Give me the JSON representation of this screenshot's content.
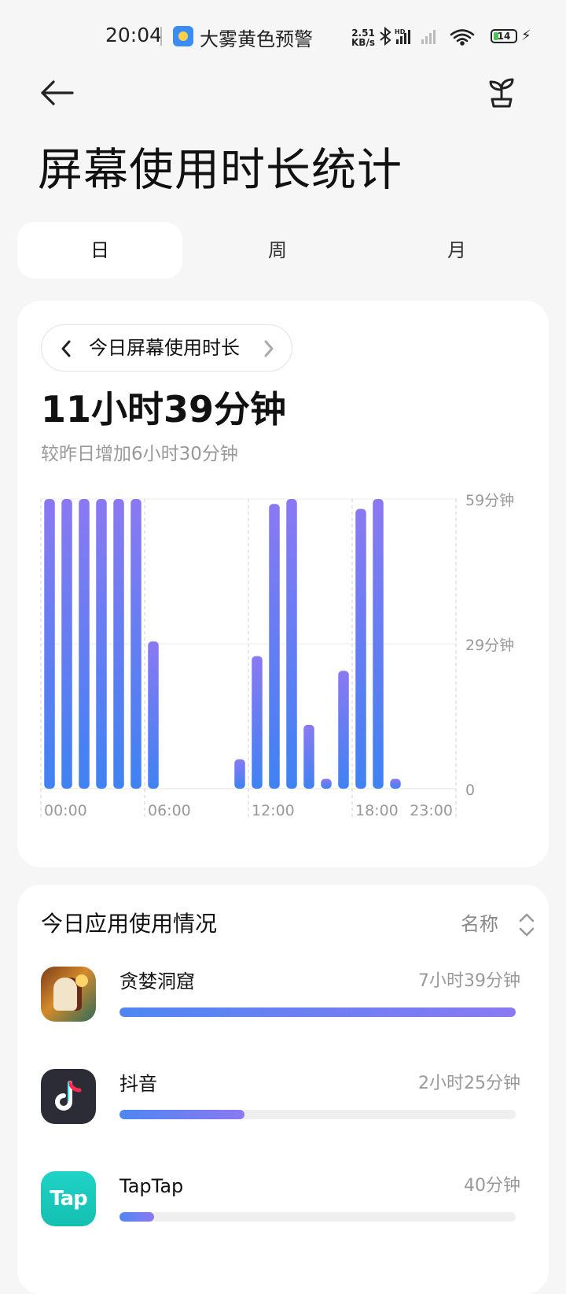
{
  "status_bar": {
    "time": "20:04",
    "alert": "大雾黄色预警",
    "net_speed_value": "2.51",
    "net_speed_unit": "KB/s",
    "battery": "14"
  },
  "header": {
    "title": "屏幕使用时长统计",
    "back_icon": "arrow-left-icon",
    "action_icon": "sprout-icon"
  },
  "tabs": [
    {
      "label": "日",
      "active": true
    },
    {
      "label": "周",
      "active": false
    },
    {
      "label": "月",
      "active": false
    }
  ],
  "usage": {
    "date_label": "今日屏幕使用时长",
    "total": "11小时39分钟",
    "delta": "较昨日增加6小时30分钟"
  },
  "chart_data": {
    "type": "bar",
    "unit": "分钟",
    "categories": [
      "00:00",
      "01:00",
      "02:00",
      "03:00",
      "04:00",
      "05:00",
      "06:00",
      "07:00",
      "08:00",
      "09:00",
      "10:00",
      "11:00",
      "12:00",
      "13:00",
      "14:00",
      "15:00",
      "16:00",
      "17:00",
      "18:00",
      "19:00",
      "20:00",
      "21:00",
      "22:00",
      "23:00"
    ],
    "values": [
      59,
      59,
      59,
      59,
      59,
      59,
      30,
      0,
      0,
      0,
      0,
      6,
      27,
      58,
      59,
      13,
      2,
      24,
      57,
      59,
      2,
      0,
      0,
      0
    ],
    "x_tick_labels": [
      "00:00",
      "06:00",
      "12:00",
      "18:00",
      "23:00"
    ],
    "y_tick_labels": [
      "59分钟",
      "29分钟",
      "0"
    ],
    "ylim": [
      0,
      59
    ],
    "grid": true,
    "colors": {
      "top": "#8a79f2",
      "bottom": "#3f82f2"
    }
  },
  "apps": {
    "title": "今日应用使用情况",
    "sort_label": "名称",
    "items": [
      {
        "name": "贪婪洞窟",
        "time": "7小时39分钟",
        "fraction": 1.0,
        "icon": "game-icon"
      },
      {
        "name": "抖音",
        "time": "2小时25分钟",
        "fraction": 0.316,
        "icon": "douyin-icon"
      },
      {
        "name": "TapTap",
        "time": "40分钟",
        "fraction": 0.087,
        "icon": "taptap-icon",
        "icon_text": "Tap"
      }
    ]
  }
}
